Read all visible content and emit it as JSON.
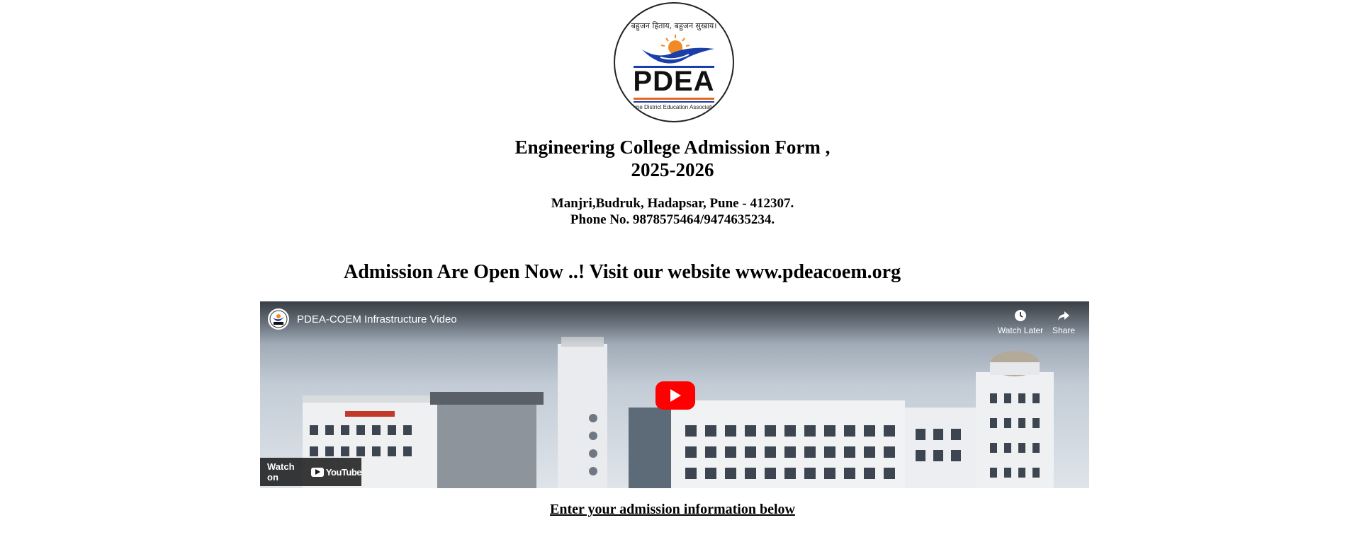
{
  "logo": {
    "motto": "बहुजन हिताय, बहुजन सुखाय।",
    "name": "PDEA",
    "subtitle": "Pune District Education Association"
  },
  "header": {
    "title_line1": "Engineering College Admission Form ,",
    "title_line2": "2025-2026",
    "address_line1": "Manjri,Budruk, Hadapsar, Pune - 412307.",
    "address_line2": "Phone No. 9878575464/9474635234."
  },
  "banner": {
    "text": "Admission Are Open Now ..! Visit our website www.pdeacoem.org"
  },
  "video": {
    "title": "PDEA-COEM Infrastructure Video",
    "watch_later_label": "Watch Later",
    "share_label": "Share",
    "watch_on_label": "Watch on",
    "youtube_label": "YouTube"
  },
  "form": {
    "intro": "Enter your admission information below"
  },
  "colors": {
    "youtube_red": "#ff0000",
    "logo_blue": "#1a3fa8",
    "logo_orange": "#e46a1a"
  }
}
